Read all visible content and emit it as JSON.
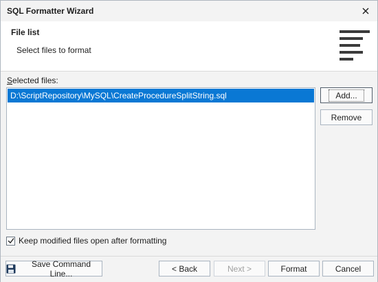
{
  "window": {
    "title": "SQL Formatter Wizard"
  },
  "header": {
    "title": "File list",
    "subtitle": "Select files to format",
    "icon": "text-align-left-icon"
  },
  "files": {
    "label": "Selected files:",
    "items": [
      {
        "path": "D:\\ScriptRepository\\MySQL\\CreateProcedureSplitString.sql",
        "selected": true
      }
    ]
  },
  "buttons": {
    "add": "Add...",
    "remove": "Remove"
  },
  "options": {
    "keep_open_label": "Keep modified files open after formatting",
    "keep_open_checked": true
  },
  "footer": {
    "save_label": "Save Command Line...",
    "back_label": "< Back",
    "next_label": "Next >",
    "format_label": "Format",
    "cancel_label": "Cancel"
  },
  "colors": {
    "selection": "#0a78d4",
    "background": "#f3f3f3"
  }
}
